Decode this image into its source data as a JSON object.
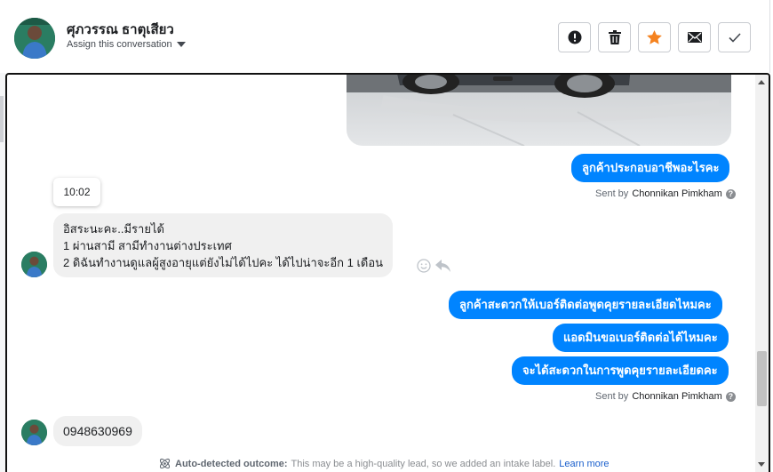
{
  "header": {
    "contact_name": "ศุภวรรณ ธาตุเสียว",
    "assign_label": "Assign this conversation"
  },
  "actions": [
    {
      "name": "report-button",
      "icon": "exclamation-circle-icon"
    },
    {
      "name": "delete-button",
      "icon": "trash-icon"
    },
    {
      "name": "star-button",
      "icon": "star-icon",
      "color": "#f5821f"
    },
    {
      "name": "mark-unread-button",
      "icon": "envelope-icon"
    },
    {
      "name": "mark-done-button",
      "icon": "check-icon"
    }
  ],
  "messages": {
    "out1": "ลูกค้าประกอบอาชีพอะไรคะ",
    "sent_by_label": "Sent by",
    "sender": "Chonnikan Pimkham",
    "timestamp": "10:02",
    "in1_lines": [
      "อิสระนะคะ..มีรายได้",
      "1 ผ่านสามี สามีทำงานต่างประเทศ",
      "2 ดิฉันทำงานดูแลผู้สูงอายุแต่ยังไม่ได้ไปคะ ได้ไปน่าจะอีก 1 เดือน"
    ],
    "out2": "ลูกค้าสะดวกให้เบอร์ติดต่อพูดคุยรายละเอียดไหมคะ",
    "out3": "แอดมินขอเบอร์ติดต่อได้ไหมคะ",
    "out4": "จะได้สะดวกในการพูดคุยรายละเอียดคะ",
    "in2": "0948630969"
  },
  "outcome": {
    "label": "Auto-detected outcome:",
    "text": "This may be a high-quality lead, so we added an intake label.",
    "link": "Learn more"
  },
  "colors": {
    "bubble_out": "#0084ff",
    "bubble_in": "#f0f0f0",
    "star": "#f5821f"
  }
}
